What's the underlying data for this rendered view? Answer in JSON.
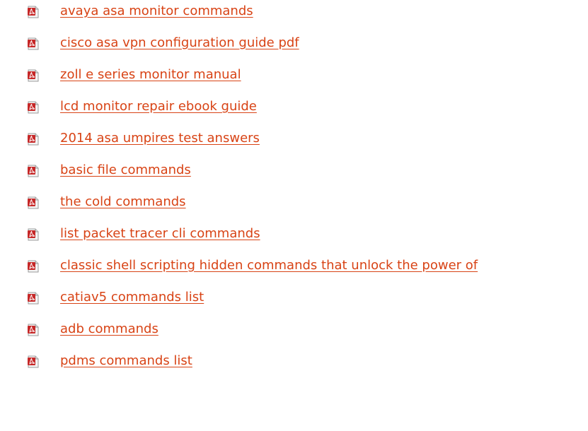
{
  "documents": {
    "icon": "pdf-icon",
    "link_color": "#d84315",
    "items": [
      {
        "title": "avaya asa monitor commands"
      },
      {
        "title": "cisco asa vpn configuration guide pdf"
      },
      {
        "title": "zoll e series monitor manual"
      },
      {
        "title": "lcd monitor repair ebook guide"
      },
      {
        "title": "2014 asa umpires test answers"
      },
      {
        "title": "basic file commands"
      },
      {
        "title": "the cold commands"
      },
      {
        "title": "list packet tracer cli commands"
      },
      {
        "title": "classic shell scripting hidden commands that unlock the power of"
      },
      {
        "title": "catiav5 commands list"
      },
      {
        "title": "adb commands"
      },
      {
        "title": "pdms commands list"
      }
    ]
  }
}
